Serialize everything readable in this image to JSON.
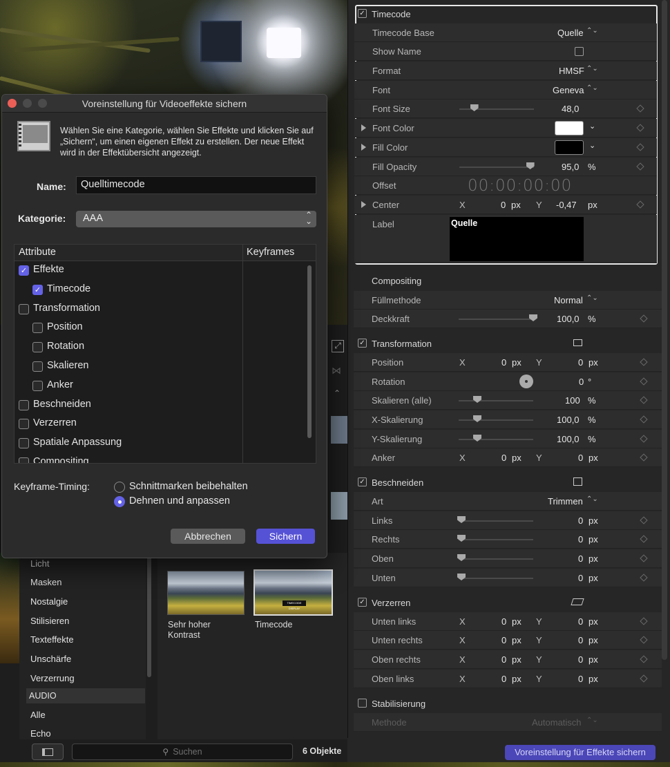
{
  "dialog": {
    "title": "Voreinstellung für Videoeffekte sichern",
    "description": "Wählen Sie eine Kategorie, wählen Sie Effekte und klicken Sie auf „Sichern“, um einen eigenen Effekt zu erstellen. Der neue Effekt wird in der Effektübersicht angezeigt.",
    "name_label": "Name:",
    "name_value": "Quelltimecode",
    "category_label": "Kategorie:",
    "category_value": "AAA",
    "col_attribute": "Attribute",
    "col_keyframes": "Keyframes",
    "attributes": [
      {
        "label": "Effekte",
        "checked": true,
        "indent": 0
      },
      {
        "label": "Timecode",
        "checked": true,
        "indent": 1
      },
      {
        "label": "Transformation",
        "checked": false,
        "indent": 0
      },
      {
        "label": "Position",
        "checked": false,
        "indent": 1
      },
      {
        "label": "Rotation",
        "checked": false,
        "indent": 1
      },
      {
        "label": "Skalieren",
        "checked": false,
        "indent": 1
      },
      {
        "label": "Anker",
        "checked": false,
        "indent": 1
      },
      {
        "label": "Beschneiden",
        "checked": false,
        "indent": 0
      },
      {
        "label": "Verzerren",
        "checked": false,
        "indent": 0
      },
      {
        "label": "Spatiale Anpassung",
        "checked": false,
        "indent": 0
      },
      {
        "label": "Compositing",
        "checked": false,
        "indent": 0
      }
    ],
    "keyframe_timing_label": "Keyframe-Timing:",
    "radio_keep": "Schnittmarken beibehalten",
    "radio_stretch": "Dehnen und anpassen",
    "selected_timing": "radio_stretch",
    "cancel_label": "Abbrechen",
    "save_label": "Sichern"
  },
  "library": {
    "items": [
      "Licht",
      "Masken",
      "Nostalgie",
      "Stilisieren",
      "Texteffekte",
      "Unschärfe",
      "Verzerrung"
    ],
    "section": "AUDIO",
    "items2": [
      "Alle",
      "Echo"
    ]
  },
  "browser": {
    "thumbs": [
      {
        "caption": "Sehr hoher Kontrast"
      },
      {
        "caption": "Timecode",
        "subtitle": "TIMECODE DISPLAY"
      }
    ],
    "search_placeholder": "Suchen",
    "count": "6 Objekte"
  },
  "inspector": {
    "timecode": {
      "header": "Timecode",
      "rows": {
        "base_label": "Timecode Base",
        "base_value": "Quelle",
        "showname_label": "Show Name",
        "format_label": "Format",
        "format_value": "HMSF",
        "font_label": "Font",
        "font_value": "Geneva",
        "fontsize_label": "Font Size",
        "fontsize_value": "48,0",
        "fontsize_level": 0.2,
        "fontcolor_label": "Font Color",
        "fontcolor_value": "#ffffff",
        "fillcolor_label": "Fill Color",
        "fillcolor_value": "#000000",
        "fillopacity_label": "Fill Opacity",
        "fillopacity_value": "95,0",
        "fillopacity_unit": "%",
        "fillopacity_level": 0.95,
        "offset_label": "Offset",
        "offset_value": "00:00:00:00",
        "center_label": "Center",
        "center_x": "0",
        "center_y": "-0,47",
        "unit_px": "px",
        "x": "X",
        "y": "Y",
        "label_label": "Label",
        "label_value": "Quelle"
      }
    },
    "compositing": {
      "header": "Compositing",
      "blend_label": "Füllmethode",
      "blend_value": "Normal",
      "opacity_label": "Deckkraft",
      "opacity_value": "100,0",
      "opacity_unit": "%",
      "opacity_level": 1.0
    },
    "transformation": {
      "header": "Transformation",
      "position_label": "Position",
      "rotation_label": "Rotation",
      "rotation_value": "0",
      "rotation_unit": "°",
      "scale_all_label": "Skalieren (alle)",
      "scale_all_value": "100",
      "scale_x_label": "X-Skalierung",
      "scale_x_value": "100,0",
      "scale_y_label": "Y-Skalierung",
      "scale_y_value": "100,0",
      "anchor_label": "Anker",
      "scale_level": 0.25
    },
    "crop": {
      "header": "Beschneiden",
      "art_label": "Art",
      "art_value": "Trimmen",
      "left": "Links",
      "right": "Rechts",
      "top": "Oben",
      "bottom": "Unten"
    },
    "distort": {
      "header": "Verzerren",
      "bl": "Unten links",
      "br": "Unten rechts",
      "tr": "Oben rechts",
      "tl": "Oben links"
    },
    "stabilization": {
      "header": "Stabilisierung",
      "method_label": "Methode",
      "method_value": "Automatisch"
    },
    "zero": "0",
    "save_effects_button": "Voreinstellung für Effekte sichern"
  },
  "colors": {
    "accent": "#6462e6",
    "save_button": "#4b47b8"
  }
}
